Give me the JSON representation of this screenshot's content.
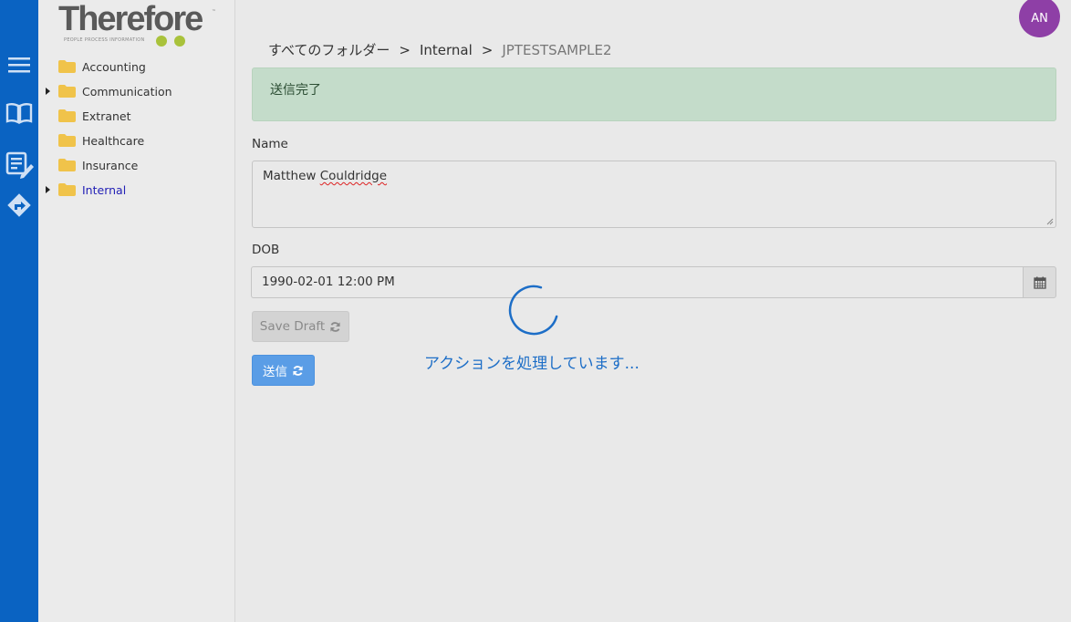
{
  "brand": {
    "logo_text": "Therefore",
    "logo_tagline": "PEOPLE  PROCESS  INFORMATION",
    "logo_tm": "™",
    "colors": {
      "rail": "#0a63c2",
      "logo_dots": "#a9c23b",
      "avatar": "#8e3fa6"
    }
  },
  "rail": {
    "items": [
      {
        "icon": "menu-icon"
      },
      {
        "icon": "book-icon"
      },
      {
        "icon": "edit-form-icon"
      },
      {
        "icon": "workflow-icon"
      }
    ]
  },
  "user": {
    "initials": "AN"
  },
  "folders": {
    "items": [
      {
        "label": "Accounting",
        "expandable": false,
        "active": false
      },
      {
        "label": "Communication",
        "expandable": true,
        "active": false
      },
      {
        "label": "Extranet",
        "expandable": false,
        "active": false
      },
      {
        "label": "Healthcare",
        "expandable": false,
        "active": false
      },
      {
        "label": "Insurance",
        "expandable": false,
        "active": false
      },
      {
        "label": "Internal",
        "expandable": true,
        "active": true
      }
    ]
  },
  "breadcrumb": {
    "items": [
      "すべてのフォルダー",
      "Internal",
      "JPTESTSAMPLE2"
    ],
    "separator": ">"
  },
  "alert": {
    "message": "送信完了",
    "color": "#c4dcca"
  },
  "form": {
    "name": {
      "label": "Name",
      "value_first": "Matthew",
      "value_last": "Couldridge"
    },
    "dob": {
      "label": "DOB",
      "value": "1990-02-01 12:00 PM"
    },
    "save_draft_label": "Save Draft",
    "submit_label": "送信"
  },
  "overlay": {
    "processing_text": "アクションを処理しています..."
  }
}
